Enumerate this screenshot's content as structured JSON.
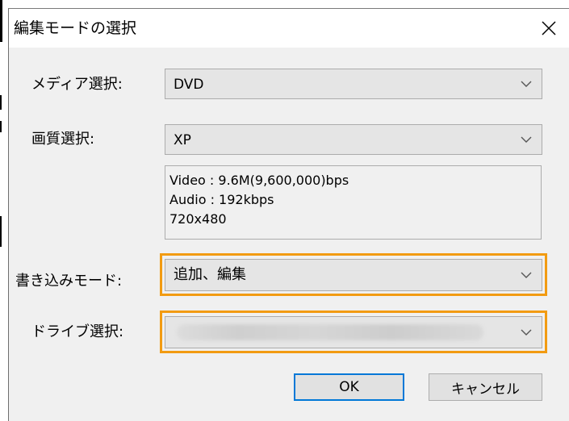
{
  "dialog": {
    "title": "編集モードの選択"
  },
  "media": {
    "label": "メディア選択:",
    "value": "DVD"
  },
  "quality": {
    "label": "画質選択:",
    "value": "XP"
  },
  "info": {
    "lines": [
      "Video : 9.6M(9,600,000)bps",
      "Audio : 192kbps",
      "720x480"
    ]
  },
  "write_mode": {
    "label": "書き込みモード:",
    "value": "追加、編集"
  },
  "drive": {
    "label": "ドライブ選択:",
    "value": ""
  },
  "buttons": {
    "ok": "OK",
    "cancel": "キャンセル"
  },
  "colors": {
    "highlight": "#f29b12",
    "dialog_bg": "#f0f0f0",
    "combo_bg": "#e5e5e5",
    "default_button_border": "#0078d7"
  },
  "icons": {
    "close": "close-icon",
    "dropdown": "chevron-down-icon"
  }
}
